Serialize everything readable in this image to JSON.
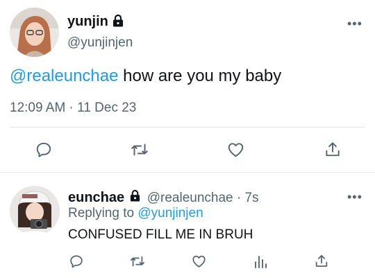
{
  "colors": {
    "accent": "#1d9bf0",
    "secondary": "#536471",
    "text": "#0f1419",
    "divider": "#e1e6ea"
  },
  "main_tweet": {
    "display_name": "yunjin",
    "handle": "@yunjinjen",
    "protected_icon": "lock-icon",
    "mention": "@realeunchae",
    "text": " how are you my baby",
    "timestamp": "12:09 AM · 11 Dec 23",
    "actions": [
      "reply-icon",
      "retweet-icon",
      "like-icon",
      "share-icon"
    ]
  },
  "reply": {
    "display_name": "eunchae",
    "handle": "@realeunchae",
    "separator": " · ",
    "time": "7s",
    "replying_label": "Replying to ",
    "replying_handle": "@yunjinjen",
    "text": "CONFUSED FILL ME IN BRUH",
    "actions": [
      "reply-icon",
      "retweet-icon",
      "like-icon",
      "analytics-icon",
      "share-icon"
    ]
  }
}
